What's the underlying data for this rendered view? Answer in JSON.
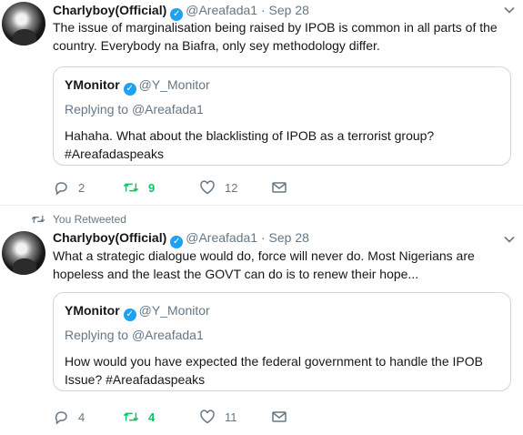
{
  "tweets": [
    {
      "retweet_label": "",
      "author": {
        "name": "Charlyboy(Official)",
        "handle": "@Areafada1",
        "date": "Sep 28"
      },
      "text": "The issue of marginalisation being raised by IPOB is common in all parts of the country. Everybody na Biafra, only sey methodology differ.",
      "quote": {
        "name": "YMonitor",
        "handle": "@Y_Monitor",
        "replying_to_label": "Replying to",
        "replying_to_handle": "@Areafada1",
        "text": "Hahaha. What about the blacklisting of IPOB as a terrorist group? #Areafadaspeaks"
      },
      "actions": {
        "replies": "2",
        "retweets": "9",
        "likes": "12"
      }
    },
    {
      "retweet_label": "You Retweeted",
      "author": {
        "name": "Charlyboy(Official)",
        "handle": "@Areafada1",
        "date": "Sep 28"
      },
      "text": "What a strategic dialogue would do, force will never do. Most Nigerians are hopeless and the least the GOVT can do is to renew their hope...",
      "quote": {
        "name": "YMonitor",
        "handle": "@Y_Monitor",
        "replying_to_label": "Replying to",
        "replying_to_handle": "@Areafada1",
        "text": "How would you have expected the federal government to handle the IPOB Issue? #Areafadaspeaks"
      },
      "actions": {
        "replies": "4",
        "retweets": "4",
        "likes": "11"
      }
    }
  ],
  "symbols": {
    "separator": "·"
  },
  "colors": {
    "accent": "#1da1f2",
    "retweet_green": "#17bf63",
    "muted": "#657786",
    "border": "#ccd6dd"
  },
  "icons": [
    "reply-icon",
    "retweet-icon",
    "like-icon",
    "dm-icon",
    "chevron-down-icon",
    "verified-icon"
  ]
}
